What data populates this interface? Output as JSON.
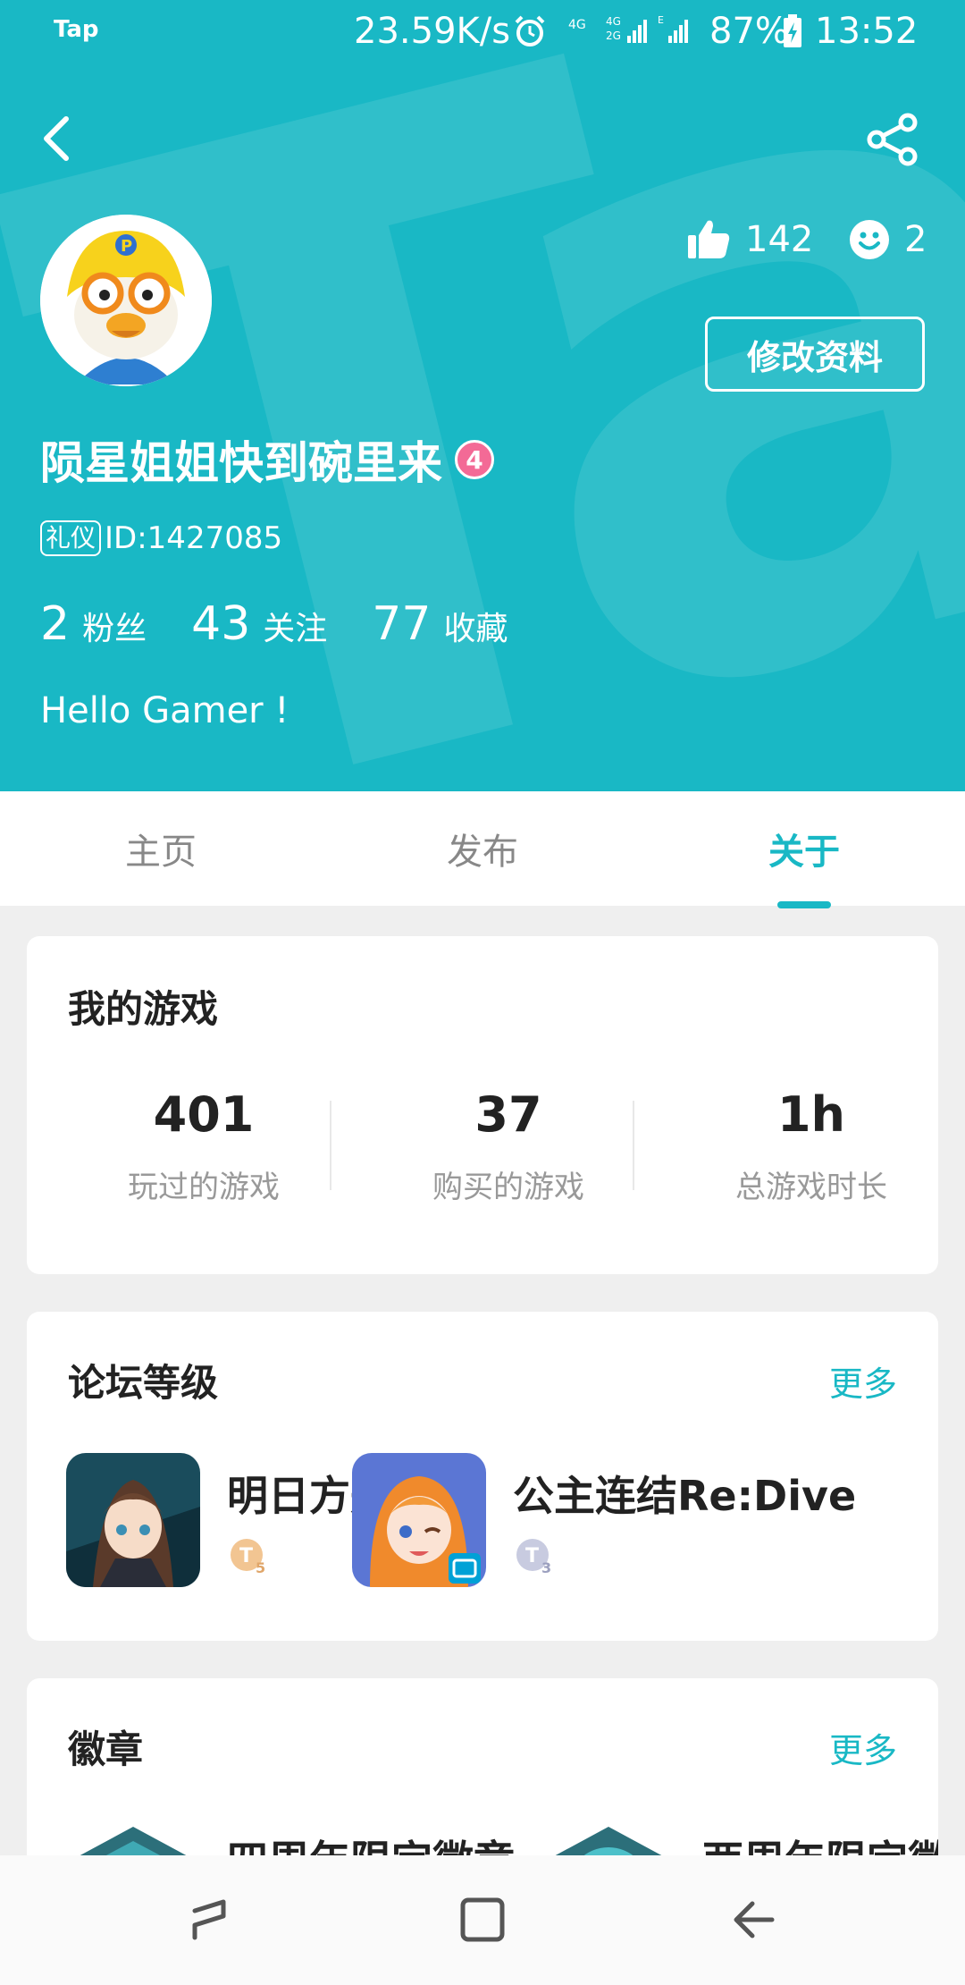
{
  "status_bar": {
    "carrier": "Tap",
    "speed": "23.59K/s",
    "network": "4G 4G 2G E",
    "battery": "87%",
    "time": "13:52"
  },
  "profile": {
    "likes": "142",
    "smiles": "2",
    "edit_label": "修改资料",
    "name": "陨星姐姐快到碗里来",
    "level": "4",
    "tag": "礼仪",
    "id": "ID:1427085",
    "stats": [
      {
        "num": "2",
        "label": "粉丝"
      },
      {
        "num": "43",
        "label": "关注"
      },
      {
        "num": "77",
        "label": "收藏"
      }
    ],
    "bio": "Hello Gamer !"
  },
  "tabs": [
    {
      "label": "主页"
    },
    {
      "label": "发布"
    },
    {
      "label": "关于"
    }
  ],
  "my_games": {
    "title": "我的游戏",
    "stats": [
      {
        "num": "401",
        "label": "玩过的游戏"
      },
      {
        "num": "37",
        "label": "购买的游戏"
      },
      {
        "num": "1h",
        "label": "总游戏时长"
      }
    ]
  },
  "forum_level": {
    "title": "论坛等级",
    "more": "更多",
    "items": [
      {
        "name": "明日方舟",
        "level": "5"
      },
      {
        "name": "公主连结Re:Dive",
        "level": "3"
      }
    ]
  },
  "badges": {
    "title": "徽章",
    "more": "更多",
    "items": [
      {
        "name": "四周年限定徽章"
      },
      {
        "name": "两周年限定徽章"
      }
    ]
  },
  "colors": {
    "accent": "#19b8c5",
    "level_badge": "#f36a96"
  }
}
